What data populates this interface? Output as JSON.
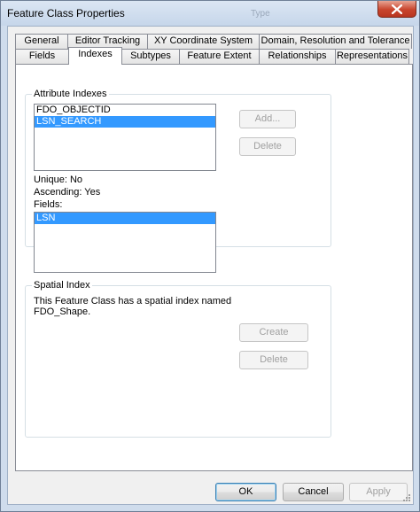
{
  "window": {
    "title": "Feature Class Properties",
    "background_title": "Type"
  },
  "tabs": {
    "row1": [
      {
        "label": "General"
      },
      {
        "label": "Editor Tracking"
      },
      {
        "label": "XY Coordinate System"
      },
      {
        "label": "Domain, Resolution and Tolerance"
      }
    ],
    "row2": [
      {
        "label": "Fields"
      },
      {
        "label": "Indexes",
        "active": true
      },
      {
        "label": "Subtypes"
      },
      {
        "label": "Feature Extent"
      },
      {
        "label": "Relationships"
      },
      {
        "label": "Representations"
      }
    ]
  },
  "attribute_indexes": {
    "group_label": "Attribute Indexes",
    "items": [
      "FDO_OBJECTID",
      "LSN_SEARCH"
    ],
    "selected_item": "LSN_SEARCH",
    "add_label": "Add...",
    "delete_label": "Delete",
    "unique_text": "Unique: No",
    "ascending_text": "Ascending: Yes",
    "fields_label": "Fields:",
    "fields_items": [
      "LSN"
    ]
  },
  "spatial_index": {
    "group_label": "Spatial Index",
    "description_line1": "This Feature Class has a spatial index named",
    "description_line2": "FDO_Shape.",
    "create_label": "Create",
    "delete_label": "Delete"
  },
  "footer": {
    "ok_label": "OK",
    "cancel_label": "Cancel",
    "apply_label": "Apply"
  },
  "colors": {
    "selection": "#3399ff",
    "close_button": "#c8442c",
    "frame": "#cfdcec"
  }
}
